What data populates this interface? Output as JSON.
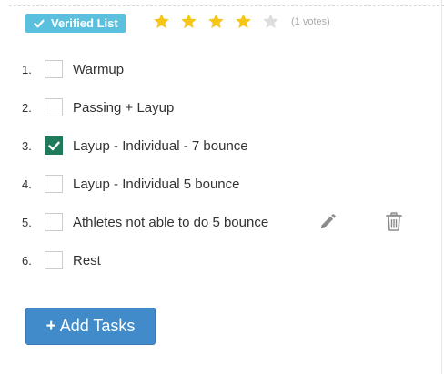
{
  "badge": {
    "label": "Verified List",
    "icon": "check-icon",
    "color": "#5bc0de"
  },
  "rating": {
    "value": 4,
    "max": 5,
    "votes_text": "(1 votes)",
    "filled_color": "#f5c518",
    "empty_color": "#dddddd"
  },
  "tasks": [
    {
      "number": "1.",
      "label": "Warmup",
      "checked": false
    },
    {
      "number": "2.",
      "label": "Passing + Layup",
      "checked": false
    },
    {
      "number": "3.",
      "label": "Layup - Individual - 7 bounce",
      "checked": true
    },
    {
      "number": "4.",
      "label": "Layup - Individual 5 bounce",
      "checked": false
    },
    {
      "number": "5.",
      "label": "Athletes not able to do 5 bounce",
      "checked": false,
      "actions": [
        "pencil-icon",
        "trash-icon"
      ]
    },
    {
      "number": "6.",
      "label": "Rest",
      "checked": false
    }
  ],
  "add_button": {
    "icon": "+",
    "label": "Add Tasks",
    "color": "#428bca"
  },
  "colors": {
    "checked_box": "#1f7a5b"
  }
}
